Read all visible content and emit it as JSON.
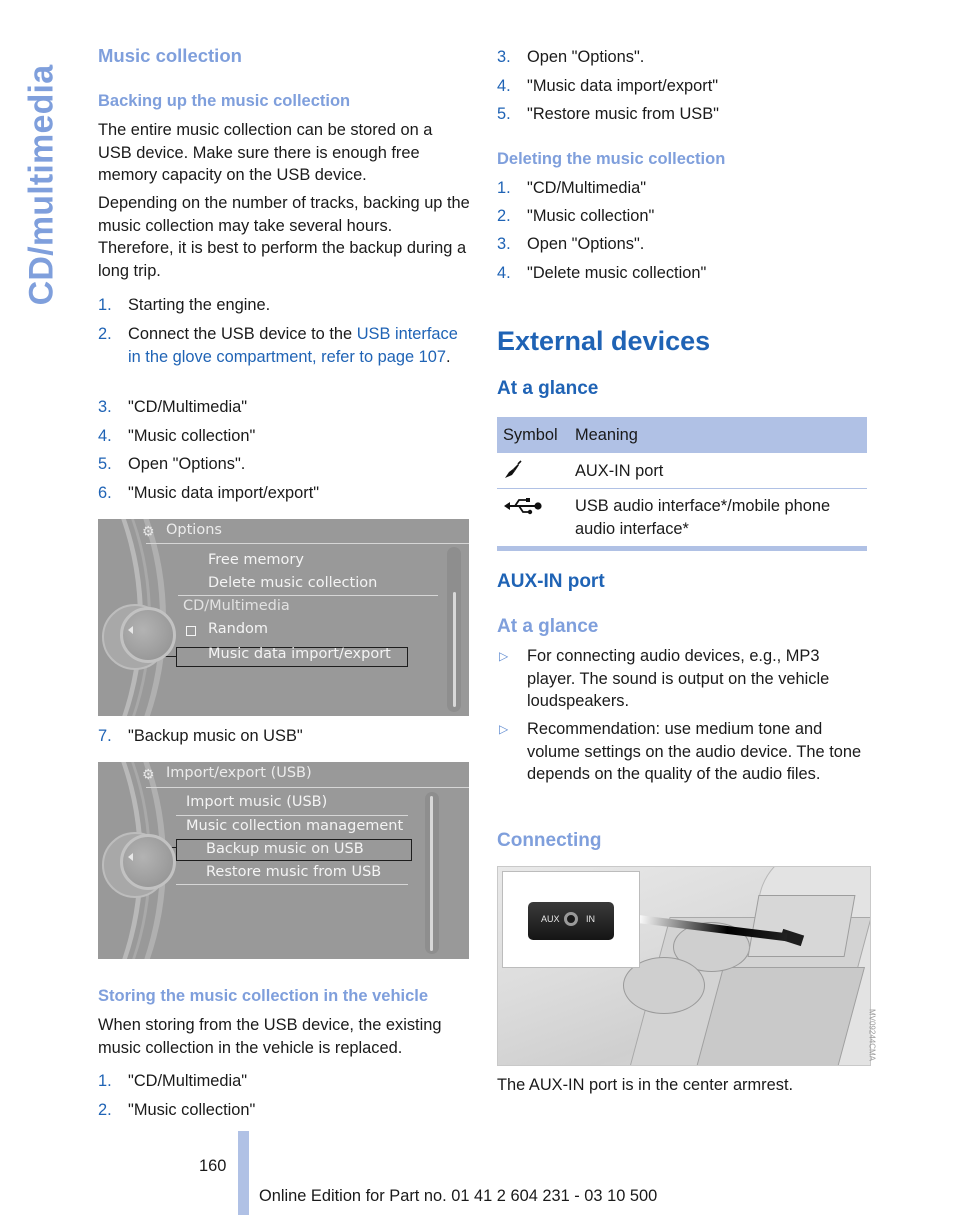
{
  "side_title": "CD/multimedia",
  "left": {
    "section_title": "Music collection",
    "backup": {
      "heading": "Backing up the music collection",
      "para1": "The entire music collection can be stored on a USB device. Make sure there is enough free memory capacity on the USB device.",
      "para2": "Depending on the number of tracks, backing up the music collection may take several hours. Therefore, it is best to perform the backup during a long trip.",
      "steps": [
        {
          "num": "1.",
          "text": "Starting the engine."
        },
        {
          "num": "2.",
          "text_before": "Connect the USB device to the ",
          "link": "USB interface in the glove compartment, refer to page 107",
          "text_after": "."
        },
        {
          "num": "3.",
          "text": "\"CD/Multimedia\""
        },
        {
          "num": "4.",
          "text": "\"Music collection\""
        },
        {
          "num": "5.",
          "text": "Open \"Options\"."
        },
        {
          "num": "6.",
          "text": "\"Music data import/export\""
        }
      ],
      "screen1": {
        "title": "Options",
        "title_icon": "music-settings-icon",
        "items": [
          "Free memory",
          "Delete music collection",
          "CD/Multimedia",
          "Random",
          "Music data import/export"
        ],
        "selected": "Music data import/export",
        "random_checked": false
      },
      "step7": {
        "num": "7.",
        "text": "\"Backup music on USB\""
      },
      "screen2": {
        "title": "Import/export (USB)",
        "title_icon": "music-settings-icon",
        "items": [
          "Import music (USB)",
          "Music collection management",
          "Backup music on USB",
          "Restore music from USB"
        ],
        "selected": "Backup music on USB"
      }
    },
    "storing": {
      "heading": "Storing the music collection in the vehicle",
      "para": "When storing from the USB device, the existing music collection in the vehicle is replaced.",
      "steps": [
        {
          "num": "1.",
          "text": "\"CD/Multimedia\""
        },
        {
          "num": "2.",
          "text": "\"Music collection\""
        }
      ]
    }
  },
  "right": {
    "storing_cont_steps": [
      {
        "num": "3.",
        "text": "Open \"Options\"."
      },
      {
        "num": "4.",
        "text": "\"Music data import/export\""
      },
      {
        "num": "5.",
        "text": "\"Restore music from USB\""
      }
    ],
    "deleting": {
      "heading": "Deleting the music collection",
      "steps": [
        {
          "num": "1.",
          "text": "\"CD/Multimedia\""
        },
        {
          "num": "2.",
          "text": "\"Music collection\""
        },
        {
          "num": "3.",
          "text": "Open \"Options\"."
        },
        {
          "num": "4.",
          "text": "\"Delete music collection\""
        }
      ]
    },
    "external": {
      "heading": "External devices",
      "at_a_glance": "At a glance",
      "table": {
        "headers": [
          "Symbol",
          "Meaning"
        ],
        "rows": [
          {
            "icon": "aux-plug-icon",
            "meaning": "AUX-IN port"
          },
          {
            "icon": "usb-icon",
            "meaning": "USB audio interface*/mobile phone audio interface*"
          }
        ]
      }
    },
    "auxin": {
      "heading": "AUX-IN port",
      "at_a_glance": "At a glance",
      "bullets": [
        "For connecting audio devices, e.g., MP3 player. The sound is output on the vehicle loudspeakers.",
        "Recommendation: use medium tone and volume settings on the audio device. The tone depends on the quality of the audio files."
      ],
      "connecting": "Connecting",
      "image": {
        "label_left": "AUX",
        "label_right": "IN",
        "code": "MV09244CMA"
      },
      "caption": "The AUX-IN port is in the center armrest."
    }
  },
  "footer": {
    "page_number": "160",
    "edition": "Online Edition for Part no. 01 41 2 604 231 - 03 10 500"
  }
}
